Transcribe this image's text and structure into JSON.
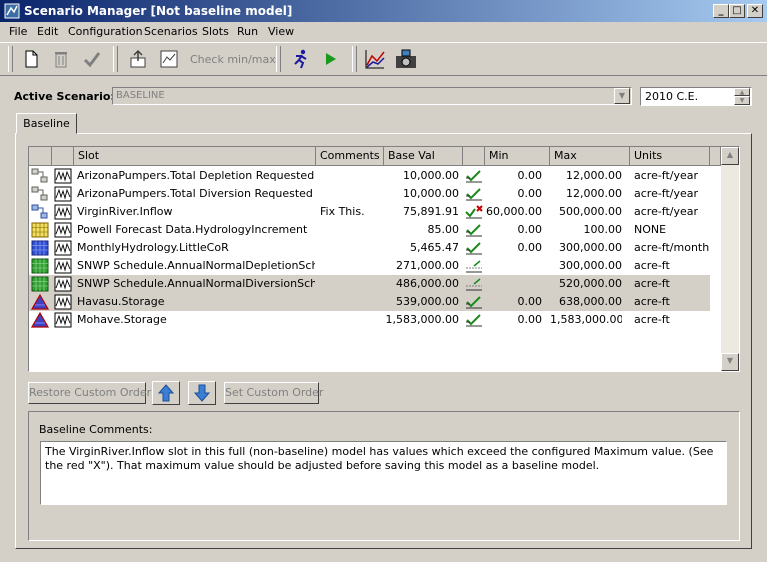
{
  "window": {
    "title": "Scenario Manager [Not baseline model]",
    "caption_buttons": [
      "_",
      "□",
      "✕"
    ]
  },
  "menu": [
    "File",
    "Edit",
    "Configuration",
    "Scenarios",
    "Slots",
    "Run",
    "View"
  ],
  "toolbar": {
    "check_minmax_label": "Check min/max"
  },
  "active_scenario": {
    "label": "Active Scenario:",
    "value": "BASELINE",
    "date_value": "2010 C.E."
  },
  "tabs": [
    {
      "label": "Baseline"
    }
  ],
  "table": {
    "headers": {
      "slot": "Slot",
      "comments": "Comments",
      "base_val": "Base Val",
      "min": "Min",
      "max": "Max",
      "units": "Units"
    },
    "rows": [
      {
        "icon": "link-icon",
        "slot": "ArizonaPumpers.Total Depletion Requested",
        "comments": "",
        "base_val": "10,000.00",
        "check": "ok",
        "min": "0.00",
        "max": "12,000.00",
        "units": "acre-ft/year"
      },
      {
        "icon": "link-icon",
        "slot": "ArizonaPumpers.Total Diversion Requested",
        "comments": "",
        "base_val": "10,000.00",
        "check": "ok",
        "min": "0.00",
        "max": "12,000.00",
        "units": "acre-ft/year"
      },
      {
        "icon": "link-blue-icon",
        "slot": "VirginRiver.Inflow",
        "comments": "Fix This.",
        "base_val": "75,891.91",
        "check": "fail",
        "min": "60,000.00",
        "max": "500,000.00",
        "units": "acre-ft/year"
      },
      {
        "icon": "grid-yellow-icon",
        "slot": "Powell Forecast Data.HydrologyIncrement",
        "comments": "",
        "base_val": "85.00",
        "check": "ok",
        "min": "0.00",
        "max": "100.00",
        "units": "NONE"
      },
      {
        "icon": "grid-blue-icon",
        "slot": "MonthlyHydrology.LittleCoR",
        "comments": "",
        "base_val": "5,465.47",
        "check": "ok",
        "min": "0.00",
        "max": "300,000.00",
        "units": "acre-ft/month"
      },
      {
        "icon": "grid-green-icon",
        "slot": "SNWP Schedule.AnnualNormalDepletionSchedule",
        "comments": "",
        "base_val": "271,000.00",
        "check": "partial",
        "min": "",
        "max": "300,000.00",
        "units": "acre-ft"
      },
      {
        "icon": "grid-green-icon",
        "slot": "SNWP Schedule.AnnualNormalDiversionSchedule",
        "comments": "",
        "base_val": "486,000.00",
        "check": "partial",
        "min": "",
        "max": "520,000.00",
        "units": "acre-ft",
        "selected": true
      },
      {
        "icon": "reservoir-icon",
        "slot": "Havasu.Storage",
        "comments": "",
        "base_val": "539,000.00",
        "check": "ok",
        "min": "0.00",
        "max": "638,000.00",
        "units": "acre-ft",
        "selected": true
      },
      {
        "icon": "reservoir-icon",
        "slot": "Mohave.Storage",
        "comments": "",
        "base_val": "1,583,000.00",
        "check": "ok",
        "min": "0.00",
        "max": "1,583,000.00",
        "units": "acre-ft"
      }
    ]
  },
  "buttons": {
    "restore_custom_order": "Restore Custom Order",
    "set_custom_order": "Set Custom Order"
  },
  "comments": {
    "label": "Baseline Comments:",
    "text": "The VirginRiver.Inflow slot in this full (non-baseline) model has values which exceed the configured Maximum value.  (See the red \"X\").  That maximum value should be adjusted before saving this model as a baseline model."
  },
  "colors": {
    "titlebar_start": "#0a246a",
    "titlebar_end": "#a6caf0",
    "window_bg": "#d4d0c8",
    "check_green": "#1a8a1a",
    "fail_red": "#cc0000"
  }
}
